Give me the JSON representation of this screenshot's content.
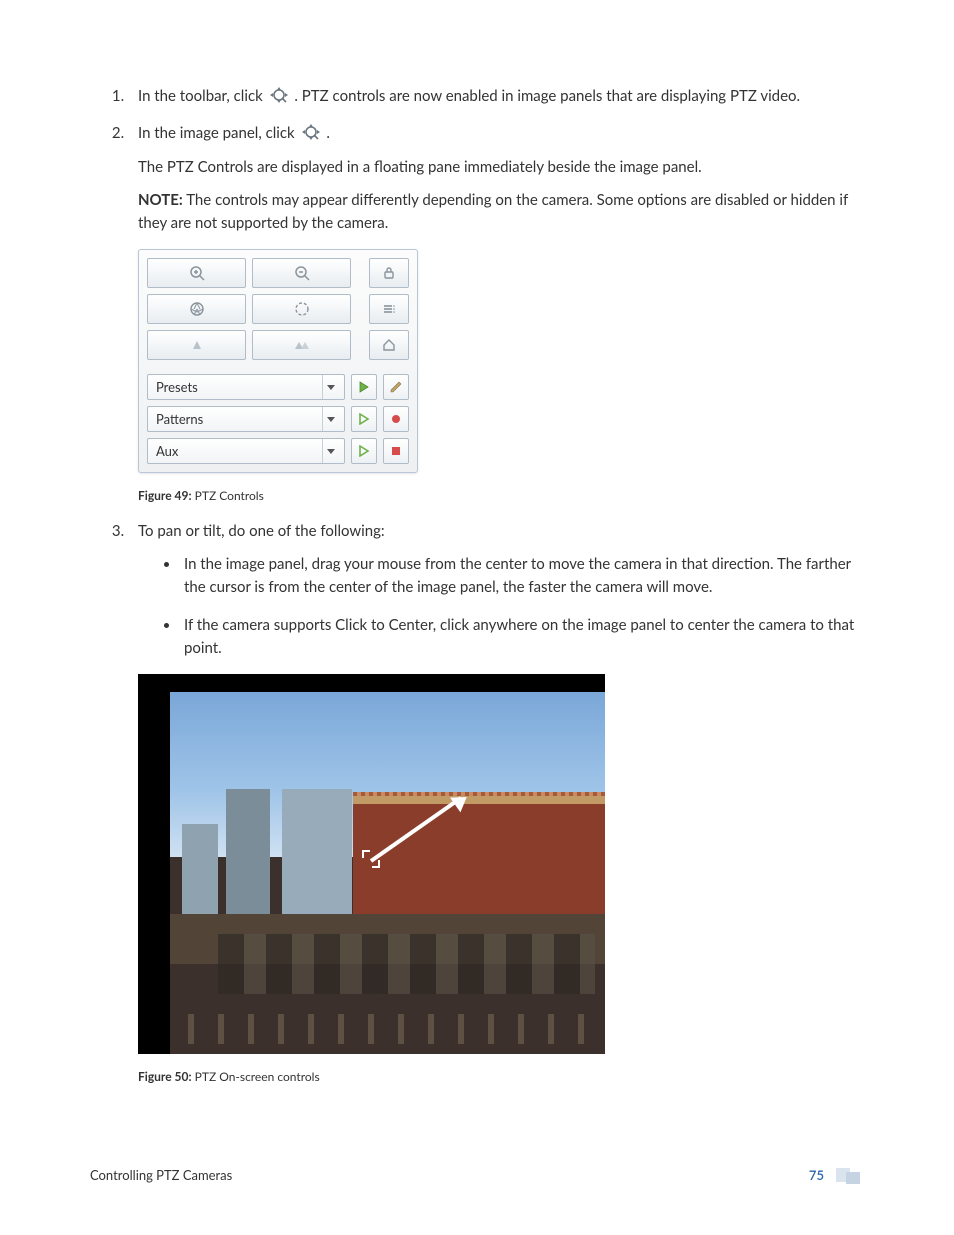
{
  "steps": {
    "s1_pre": "In the toolbar, click ",
    "s1_post": ". PTZ controls are now enabled in image panels that are displaying PTZ video.",
    "s2_pre": "In the image panel, click ",
    "s2_post": ".",
    "s2_p1": "The PTZ Controls are displayed in a floating pane immediately beside the image panel.",
    "s2_note_label": "NOTE:",
    "s2_note_text": " The controls may appear differently depending on the camera. Some options are disabled or hidden if they are not supported by the camera.",
    "s3_intro": "To pan or tilt, do one of the following:"
  },
  "ptz_panel": {
    "presets": "Presets",
    "patterns": "Patterns",
    "aux": "Aux"
  },
  "fig49": {
    "label": "Figure 49:",
    "text": " PTZ Controls"
  },
  "sub": {
    "a": "In the image panel, drag your mouse from the center to move the camera in that direction. The farther the cursor is from the center of the image panel, the faster the camera will move.",
    "b": "If the camera supports Click to Center, click anywhere on the image panel to center the camera to that point."
  },
  "fig50": {
    "label": "Figure 50:",
    "text": " PTZ On-screen controls"
  },
  "footer": {
    "title": "Controlling PTZ Cameras",
    "page": "75"
  }
}
